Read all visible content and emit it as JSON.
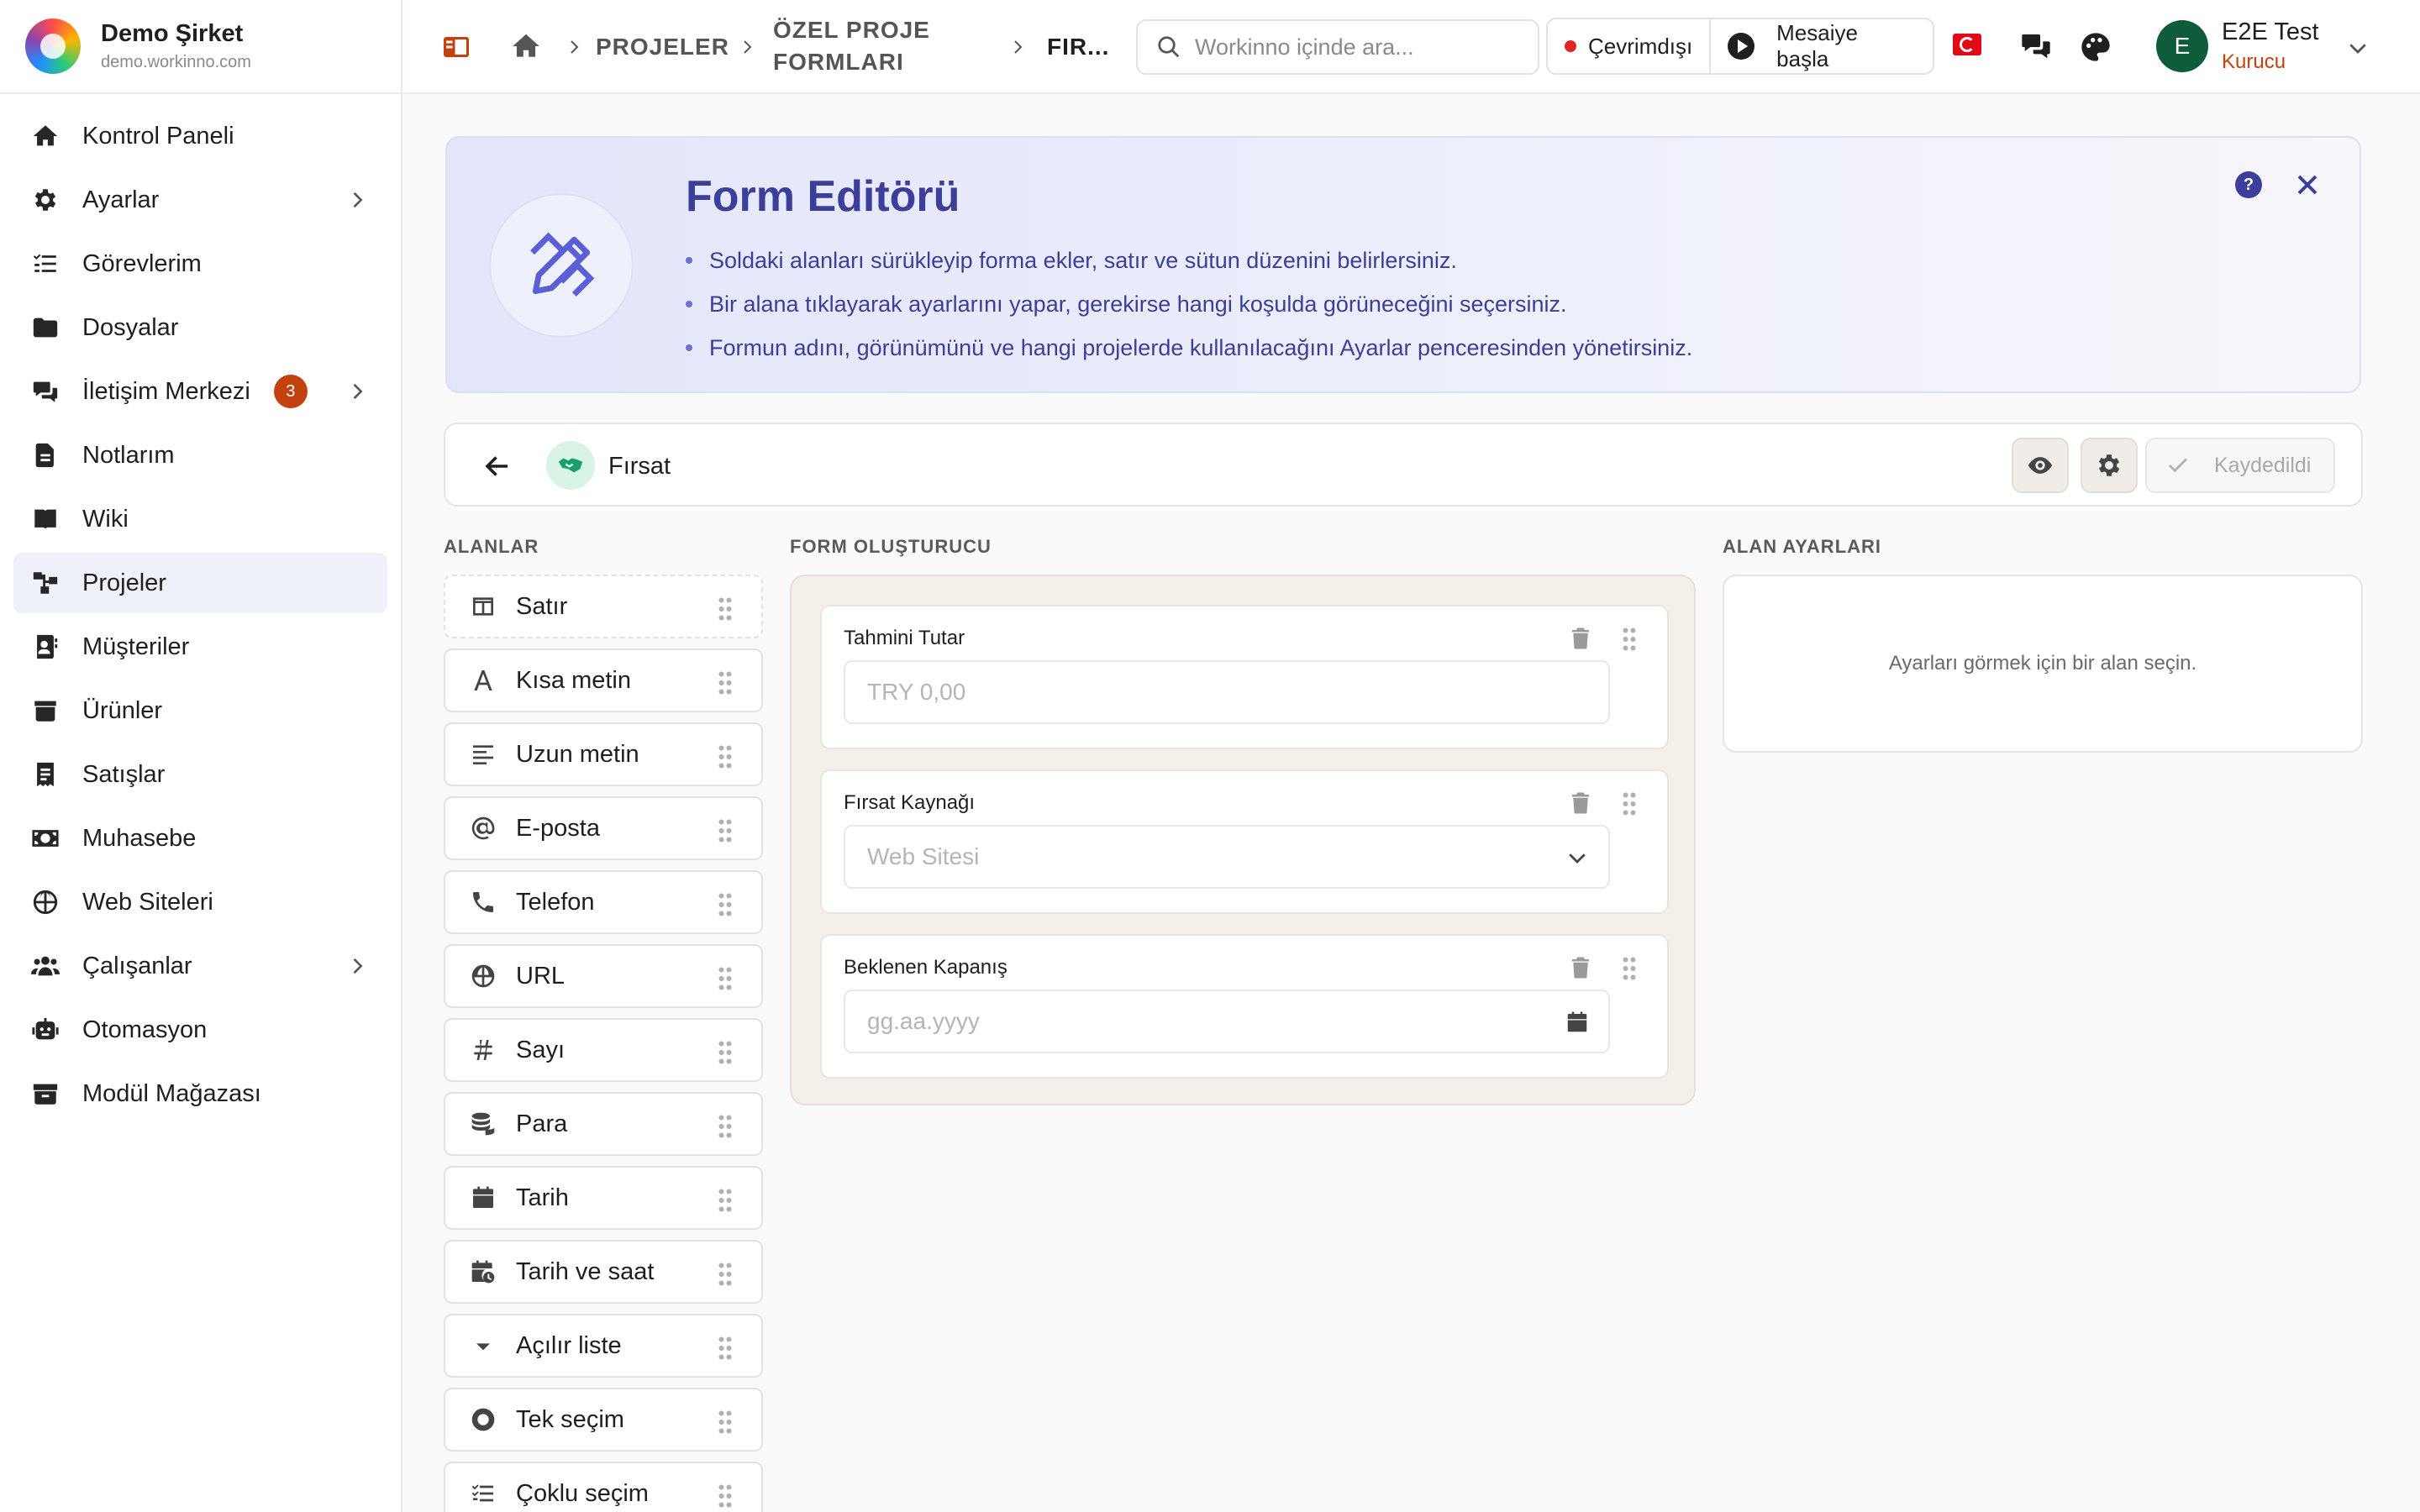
{
  "brand": {
    "name": "Demo Şirket",
    "domain": "demo.workinno.com"
  },
  "sidebar": {
    "items": [
      {
        "label": "Kontrol Paneli"
      },
      {
        "label": "Ayarlar"
      },
      {
        "label": "Görevlerim"
      },
      {
        "label": "Dosyalar"
      },
      {
        "label": "İletişim Merkezi",
        "badge": "3"
      },
      {
        "label": "Notlarım"
      },
      {
        "label": "Wiki"
      },
      {
        "label": "Projeler"
      },
      {
        "label": "Müşteriler"
      },
      {
        "label": "Ürünler"
      },
      {
        "label": "Satışlar"
      },
      {
        "label": "Muhasebe"
      },
      {
        "label": "Web Siteleri"
      },
      {
        "label": "Çalışanlar"
      },
      {
        "label": "Otomasyon"
      },
      {
        "label": "Modül Mağazası"
      }
    ]
  },
  "breadcrumb": {
    "projects": "PROJELER",
    "forms_line1": "ÖZEL PROJE",
    "forms_line2": "FORMLARI",
    "current": "FIR..."
  },
  "search": {
    "placeholder": "Workinno içinde ara..."
  },
  "presence": {
    "status": "Çevrimdışı",
    "shift": "Mesaiye başla"
  },
  "user": {
    "initial": "E",
    "name": "E2E Test",
    "role": "Kurucu"
  },
  "banner": {
    "title": "Form Editörü",
    "bullets": [
      "Soldaki alanları sürükleyip forma ekler, satır ve sütun düzenini belirlersiniz.",
      "Bir alana tıklayarak ayarlarını yapar, gerekirse hangi koşulda görüneceğini seçersiniz.",
      "Formun adını, görünümünü ve hangi projelerde kullanılacağını Ayarlar penceresinden yönetirsiniz."
    ]
  },
  "form": {
    "name": "Fırsat",
    "saved_label": "Kaydedildi"
  },
  "sections": {
    "fields": "ALANLAR",
    "builder": "FORM OLUŞTURUCU",
    "settings": "ALAN AYARLARI"
  },
  "palette": [
    {
      "label": "Satır"
    },
    {
      "label": "Kısa metin"
    },
    {
      "label": "Uzun metin"
    },
    {
      "label": "E-posta"
    },
    {
      "label": "Telefon"
    },
    {
      "label": "URL"
    },
    {
      "label": "Sayı"
    },
    {
      "label": "Para"
    },
    {
      "label": "Tarih"
    },
    {
      "label": "Tarih ve saat"
    },
    {
      "label": "Açılır liste"
    },
    {
      "label": "Tek seçim"
    },
    {
      "label": "Çoklu seçim"
    }
  ],
  "builder_fields": [
    {
      "label": "Tahmini Tutar",
      "placeholder": "TRY 0,00"
    },
    {
      "label": "Fırsat Kaynağı",
      "placeholder": "Web Sitesi"
    },
    {
      "label": "Beklenen Kapanış",
      "placeholder": "gg.aa.yyyy"
    }
  ],
  "settings_panel": {
    "empty_text": "Ayarları görmek için bir alan seçin."
  },
  "colors": {
    "accent": "#3b3f9a",
    "badge": "#c2410c",
    "avatar": "#0f5c3a",
    "builder_bg": "#f5efe9"
  }
}
